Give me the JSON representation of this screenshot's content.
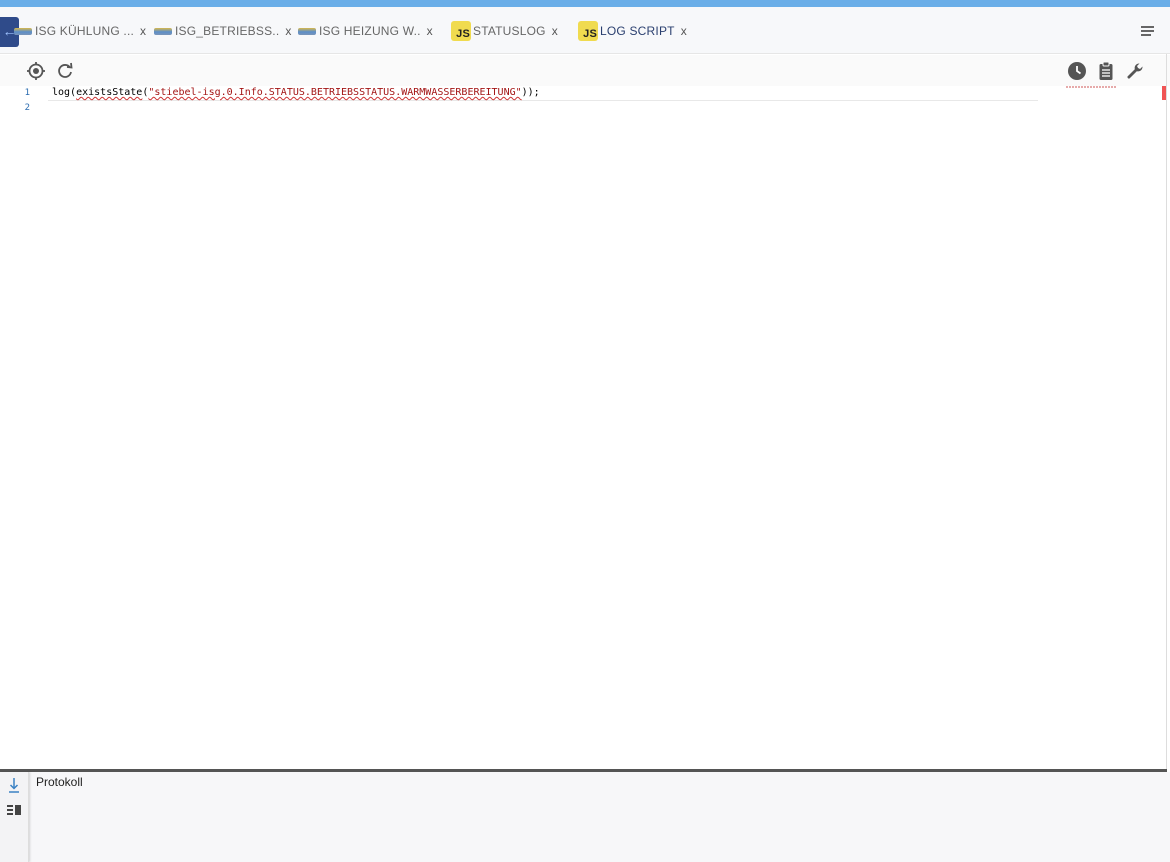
{
  "tabs": [
    {
      "label": "ISG KÜHLUNG ...",
      "close": "x",
      "icon": "flag-icon",
      "active": false
    },
    {
      "label": "ISG_BETRIEBSS..",
      "close": "x",
      "icon": "flag-icon",
      "active": false
    },
    {
      "label": "ISG HEIZUNG W..",
      "close": "x",
      "icon": "flag-icon",
      "active": false
    },
    {
      "label": "STATUSLOG",
      "close": "x",
      "icon": "js-icon",
      "active": false
    },
    {
      "label": "LOG SCRIPT",
      "close": "x",
      "icon": "js-icon",
      "active": true
    }
  ],
  "js_icon_text": "JS",
  "back_arrow": "←",
  "toolbar": {
    "left_icons": [
      "crosshair-icon",
      "refresh-icon"
    ],
    "right_icons": [
      "clock-icon",
      "clipboard-icon",
      "wrench-icon"
    ]
  },
  "editor": {
    "line_numbers": [
      "1",
      "2"
    ],
    "code": {
      "prefix": "log(",
      "fn": "existsState",
      "open": "(",
      "str": "\"stiebel-isg.0.Info.STATUS.BETRIEBSSTATUS.WARMWASSERBEREITUNG\"",
      "suffix": "));"
    }
  },
  "log_panel": {
    "title": "Protokoll",
    "icons": [
      "scroll-down-icon",
      "toggle-columns-icon"
    ]
  },
  "colors": {
    "accent": "#2a3f6f",
    "top_bar": "#6aaee8",
    "error_marker": "#f05454"
  }
}
